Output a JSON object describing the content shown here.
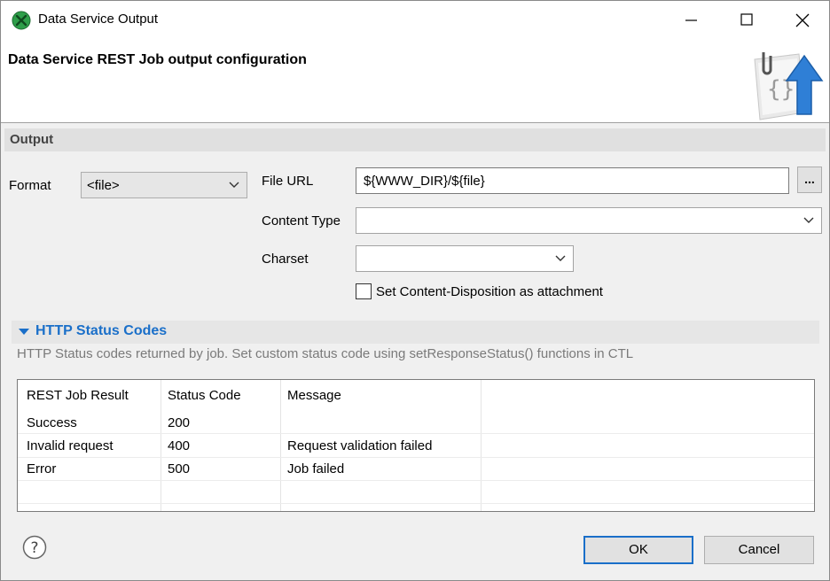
{
  "window": {
    "title": "Data Service Output",
    "banner_title": "Data Service REST Job output configuration"
  },
  "output": {
    "section_label": "Output",
    "format_label": "Format",
    "format_value": "<file>",
    "file_url_label": "File URL",
    "file_url_value": "${WWW_DIR}/${file}",
    "browse_label": "...",
    "content_type_label": "Content Type",
    "content_type_value": "",
    "charset_label": "Charset",
    "charset_value": "",
    "disposition_label": "Set Content-Disposition as attachment",
    "disposition_checked": false
  },
  "http_status": {
    "header": "HTTP Status Codes",
    "description": "HTTP Status codes returned by job. Set custom status code using setResponseStatus() functions in CTL",
    "columns": [
      "REST Job Result",
      "Status Code",
      "Message"
    ],
    "rows": [
      {
        "result": "Success",
        "code": "200",
        "message": ""
      },
      {
        "result": "Invalid request",
        "code": "400",
        "message": "Request validation failed"
      },
      {
        "result": "Error",
        "code": "500",
        "message": "Job failed"
      }
    ]
  },
  "footer": {
    "ok_label": "OK",
    "cancel_label": "Cancel"
  },
  "colors": {
    "accent": "#1a6fc9",
    "app_icon": "#2e9e4a"
  }
}
